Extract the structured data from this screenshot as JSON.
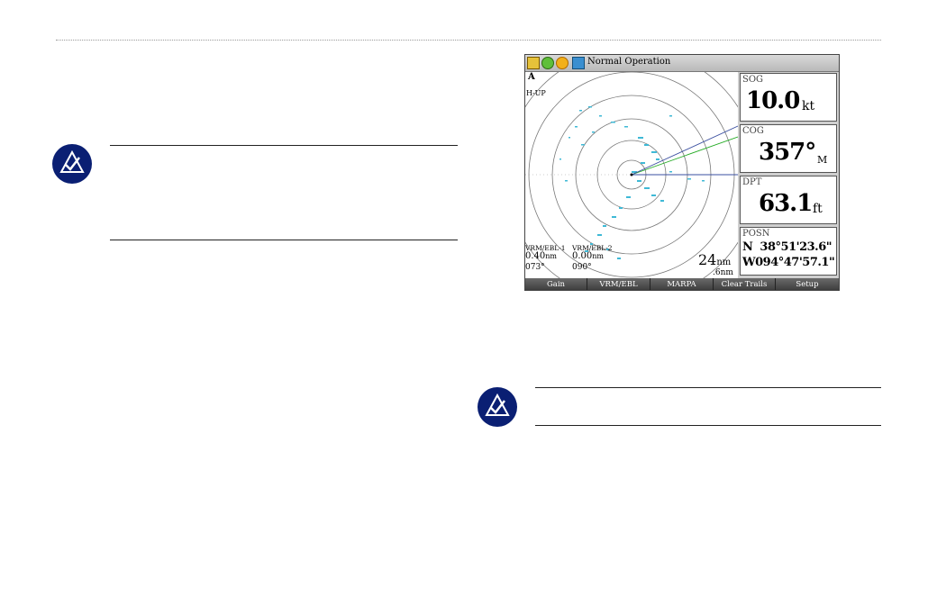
{
  "screen": {
    "status_text": "Normal Operation",
    "status_icons": [
      "alarm-bell-icon",
      "gps-signal-icon",
      "sun-icon",
      "radar-transmit-icon"
    ]
  },
  "radar": {
    "heading_mode": "H-UP",
    "north_arrow": "A",
    "vrm_ebl_1": {
      "label": "VRM/EBL-1",
      "range_value": "0.40",
      "range_unit": "nm",
      "bearing": "073°"
    },
    "vrm_ebl_2": {
      "label": "VRM/EBL-2",
      "range_value": "0.00",
      "range_unit": "nm",
      "bearing": "090°"
    },
    "range": {
      "value": "24",
      "unit": "nm"
    },
    "ring_spacing": ".6nm"
  },
  "data_fields": [
    {
      "label": "SOG",
      "value": "10.0",
      "unit": "kt"
    },
    {
      "label": "COG",
      "value": "357°",
      "unit": "M"
    },
    {
      "label": "DPT",
      "value": "63.1",
      "unit": "ft"
    },
    {
      "label": "POSN",
      "lat": "N  38°51'23.6\"",
      "lon": "W094°47'57.1\""
    }
  ],
  "softkeys": [
    "Gain",
    "VRM/EBL",
    "MARPA",
    "Clear Trails",
    "Setup"
  ],
  "colors": {
    "note_icon": "#0a1f73",
    "radar_echo": "#3fb9d6",
    "heading_line": "#22aa22",
    "ebl_line": "#3a4fa0"
  }
}
